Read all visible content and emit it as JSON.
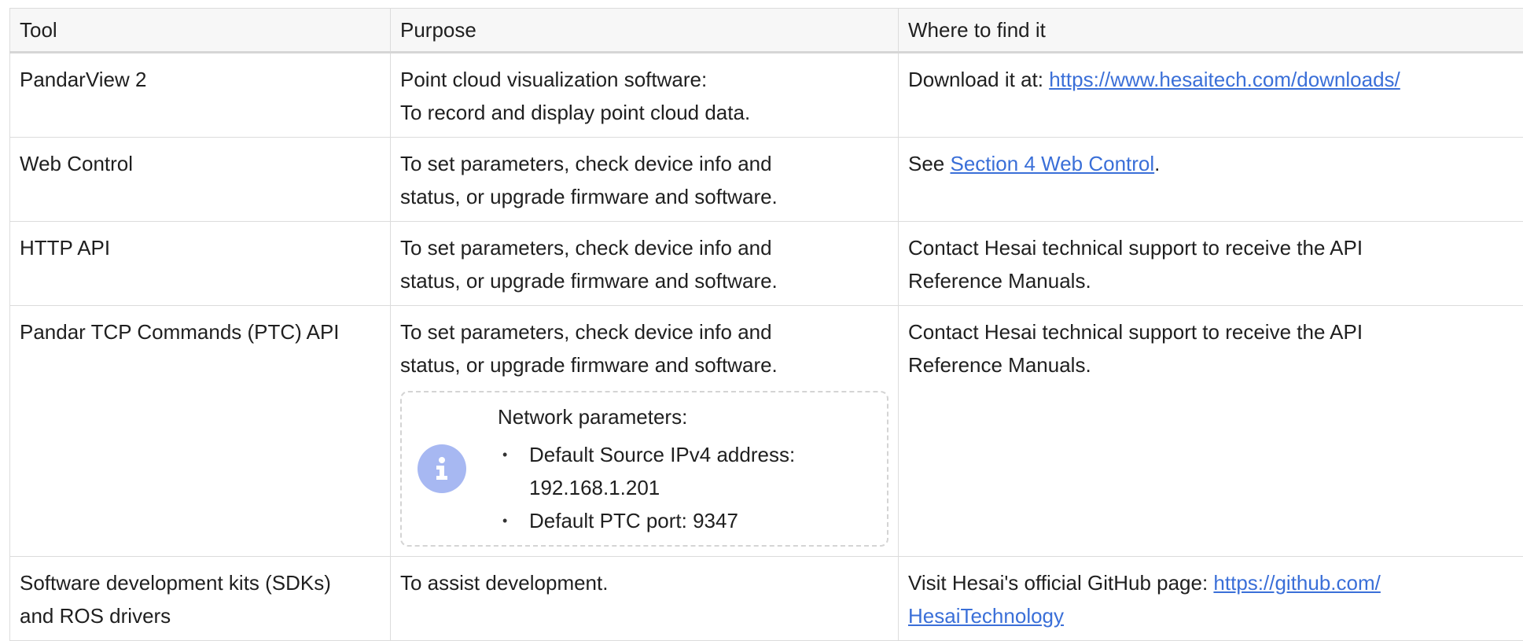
{
  "table": {
    "headers": [
      "Tool",
      "Purpose",
      "Where to find it"
    ],
    "rows": [
      {
        "tool": [
          "PandarView 2"
        ],
        "purpose": [
          "Point cloud visualization software:",
          "To record and display point cloud data."
        ],
        "where": {
          "prefix": "Download it at: ",
          "link": "https://www.hesaitech.com/downloads/",
          "suffix": ""
        }
      },
      {
        "tool": [
          "Web Control"
        ],
        "purpose": [
          "To set parameters, check device info and",
          "status, or upgrade firmware and software."
        ],
        "where": {
          "prefix": "See ",
          "link": "Section 4 Web Control",
          "suffix": "."
        }
      },
      {
        "tool": [
          "HTTP API"
        ],
        "purpose": [
          "To set parameters, check device info and",
          "status, or upgrade firmware and software."
        ],
        "where": {
          "lines": [
            "Contact Hesai technical support to receive the API",
            "Reference Manuals."
          ]
        }
      },
      {
        "tool": [
          "Pandar TCP Commands (PTC) API"
        ],
        "purpose": [
          "To set parameters, check device info and",
          "status, or upgrade firmware and software."
        ],
        "note": {
          "icon": "info-icon",
          "title": "Network parameters:",
          "items": [
            [
              "Default Source IPv4 address:",
              "192.168.1.201"
            ],
            [
              "Default PTC port: 9347"
            ]
          ]
        },
        "where": {
          "lines": [
            "Contact Hesai technical support to receive the API",
            "Reference Manuals."
          ]
        }
      },
      {
        "tool": [
          "Software development kits (SDKs)",
          "and ROS drivers"
        ],
        "purpose": [
          "To assist development."
        ],
        "where": {
          "prefix": "Visit Hesai's official GitHub page: ",
          "link_lines": [
            "https://github.com/",
            "HesaiTechnology"
          ]
        }
      }
    ]
  },
  "colors": {
    "link": "#3a6fd8",
    "note_icon_bg": "#a7b8f2",
    "border": "#dcdcdc",
    "header_bg": "#f7f7f7"
  }
}
